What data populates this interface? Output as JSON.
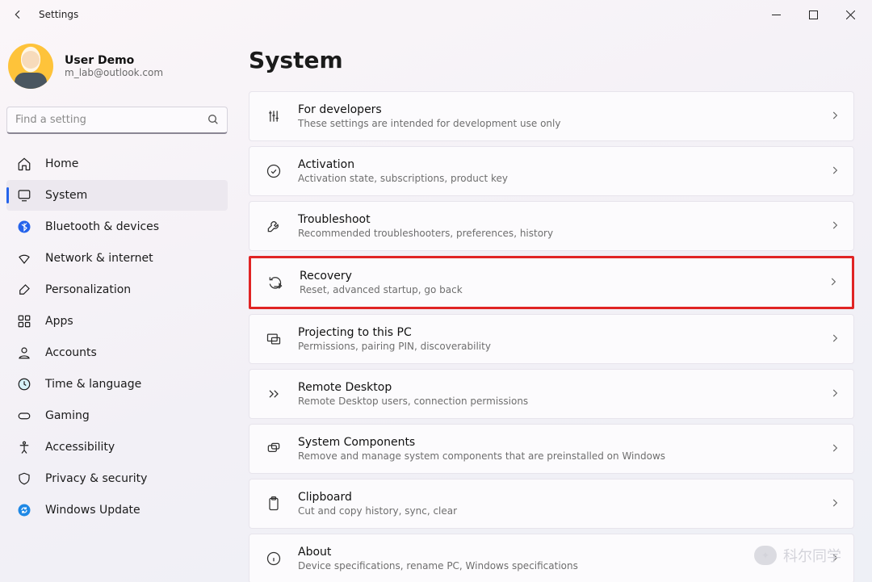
{
  "window": {
    "title": "Settings"
  },
  "user": {
    "name": "User Demo",
    "email": "m_lab@outlook.com"
  },
  "search": {
    "placeholder": "Find a setting"
  },
  "nav": {
    "items": [
      {
        "label": "Home",
        "icon": "home",
        "active": false
      },
      {
        "label": "System",
        "icon": "system",
        "active": true
      },
      {
        "label": "Bluetooth & devices",
        "icon": "bt",
        "active": false
      },
      {
        "label": "Network & internet",
        "icon": "wifi",
        "active": false
      },
      {
        "label": "Personalization",
        "icon": "brush",
        "active": false
      },
      {
        "label": "Apps",
        "icon": "apps",
        "active": false
      },
      {
        "label": "Accounts",
        "icon": "account",
        "active": false
      },
      {
        "label": "Time & language",
        "icon": "time",
        "active": false
      },
      {
        "label": "Gaming",
        "icon": "gaming",
        "active": false
      },
      {
        "label": "Accessibility",
        "icon": "access",
        "active": false
      },
      {
        "label": "Privacy & security",
        "icon": "privacy",
        "active": false
      },
      {
        "label": "Windows Update",
        "icon": "update",
        "active": false
      }
    ]
  },
  "page": {
    "title": "System"
  },
  "cards": [
    {
      "title": "For developers",
      "sub": "These settings are intended for development use only",
      "icon": "dev",
      "highlight": false
    },
    {
      "title": "Activation",
      "sub": "Activation state, subscriptions, product key",
      "icon": "activation",
      "highlight": false
    },
    {
      "title": "Troubleshoot",
      "sub": "Recommended troubleshooters, preferences, history",
      "icon": "wrench",
      "highlight": false
    },
    {
      "title": "Recovery",
      "sub": "Reset, advanced startup, go back",
      "icon": "recovery",
      "highlight": true
    },
    {
      "title": "Projecting to this PC",
      "sub": "Permissions, pairing PIN, discoverability",
      "icon": "project",
      "highlight": false
    },
    {
      "title": "Remote Desktop",
      "sub": "Remote Desktop users, connection permissions",
      "icon": "remote",
      "highlight": false
    },
    {
      "title": "System Components",
      "sub": "Remove and manage system components that are preinstalled on Windows",
      "icon": "components",
      "highlight": false
    },
    {
      "title": "Clipboard",
      "sub": "Cut and copy history, sync, clear",
      "icon": "clipboard",
      "highlight": false
    },
    {
      "title": "About",
      "sub": "Device specifications, rename PC, Windows specifications",
      "icon": "about",
      "highlight": false
    }
  ],
  "watermark": {
    "text": "科尔同学"
  }
}
